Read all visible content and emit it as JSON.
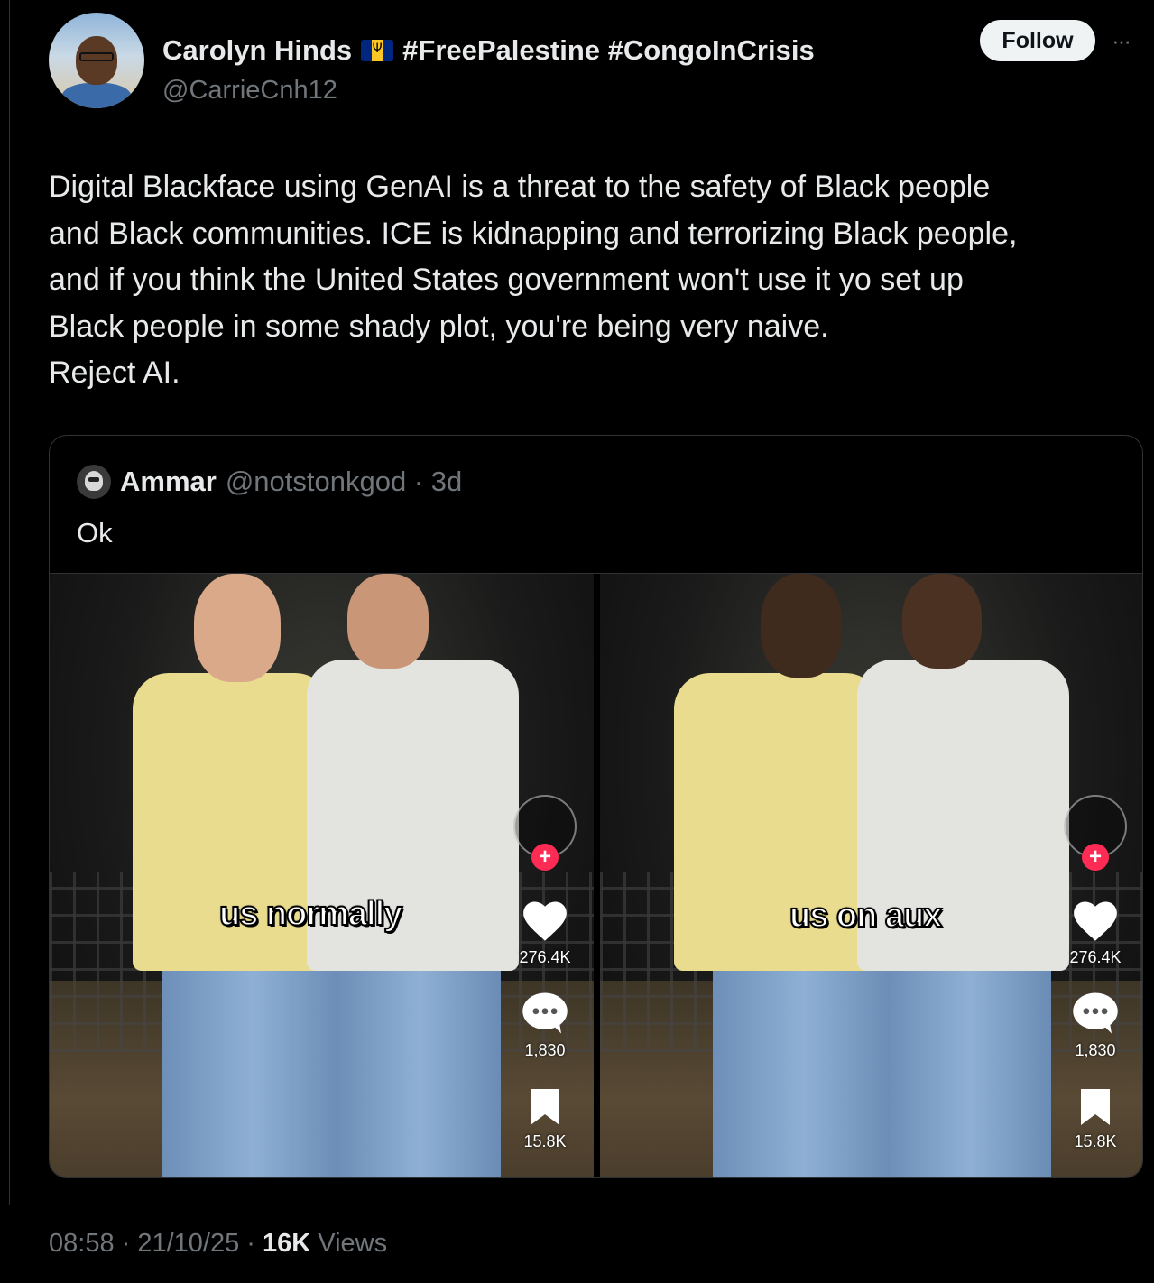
{
  "author": {
    "display_name": "Carolyn Hinds",
    "hashtags": "#FreePalestine #CongoInCrisis",
    "handle": "@CarrieCnh12",
    "flag_icon": "barbados-flag-icon"
  },
  "actions": {
    "follow_label": "Follow",
    "more_label": "···"
  },
  "tweet": {
    "text": "Digital Blackface using GenAI is a threat to the safety of Black people\nand Black communities. ICE is kidnapping and terrorizing Black people,\nand if you think the United States government won't use it yo set up\nBlack people in some shady plot, you're being very naive.\nReject AI."
  },
  "quote": {
    "name": "Ammar",
    "handle_time": "@notstonkgod · 3d",
    "text": "Ok",
    "panels": [
      {
        "caption": "us normally",
        "likes": "276.4K",
        "comments": "1,830",
        "saves": "15.8K"
      },
      {
        "caption": "us on aux",
        "likes": "276.4K",
        "comments": "1,830",
        "saves": "15.8K"
      }
    ]
  },
  "footer": {
    "time_date": "08:58 · 21/10/25 · ",
    "views_count": "16K",
    "views_label": " Views"
  },
  "colors": {
    "background": "#000000",
    "text_primary": "#e7e9ea",
    "text_secondary": "#71767b",
    "border": "#2f3336",
    "follow_bg": "#eff3f4",
    "tiktok_red": "#fe2c55"
  }
}
